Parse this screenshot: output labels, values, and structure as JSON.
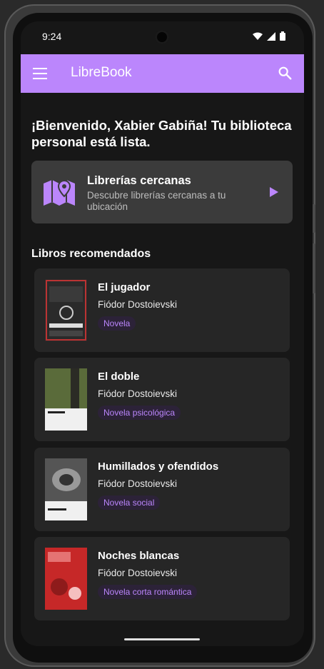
{
  "status": {
    "time": "9:24"
  },
  "appbar": {
    "title": "LibreBook",
    "menu_icon": "menu-icon",
    "search_icon": "search-icon"
  },
  "welcome": {
    "text": "¡Bienvenido, Xabier Gabiña! Tu biblioteca personal está lista."
  },
  "nearby": {
    "title": "Librerías cercanas",
    "subtitle": "Descubre librerías cercanas a tu ubicación",
    "icon": "map-icon",
    "action_icon": "play-icon"
  },
  "section": {
    "title": "Libros recomendados"
  },
  "books": [
    {
      "title": "El jugador",
      "author": "Fiódor Dostoievski",
      "tag": "Novela"
    },
    {
      "title": "El doble",
      "author": "Fiódor Dostoievski",
      "tag": "Novela psicológica"
    },
    {
      "title": "Humillados y ofendidos",
      "author": "Fiódor Dostoievski",
      "tag": "Novela social"
    },
    {
      "title": "Noches blancas",
      "author": "Fiódor Dostoievski",
      "tag": "Novela corta romántica"
    }
  ],
  "colors": {
    "accent": "#bb86fc",
    "background": "#171717",
    "card": "#262626"
  }
}
